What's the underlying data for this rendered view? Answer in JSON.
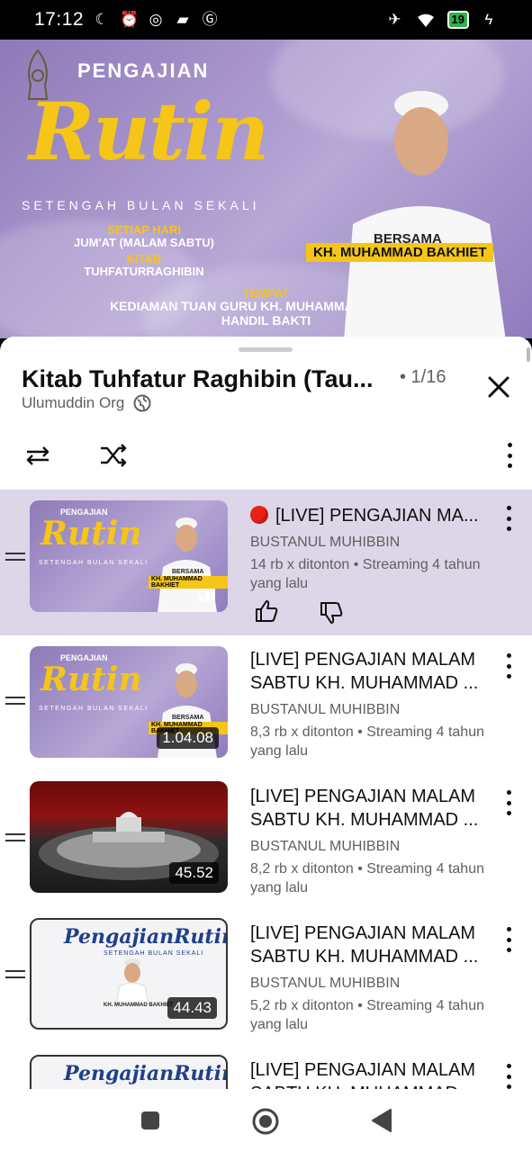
{
  "status_bar": {
    "time": "17:12",
    "battery": "19"
  },
  "video": {
    "title_top": "PENGAJIAN",
    "title_main": "Rutin",
    "subtitle": "SETENGAH BULAN SEKALI",
    "line1": "SETIAP HARI",
    "line2": "JUM'AT (MALAM SABTU)",
    "line3": "KITAB",
    "line4": "TUHFATURRAGHIBIN",
    "place_label": "TEMPAT",
    "place1": "KEDIAMAN TUAN GURU KH. MUHAMMAD BAKHIET",
    "place2": "HANDIL BAKTI",
    "with_label": "BERSAMA",
    "speaker": "KH. MUHAMMAD BAKHIET"
  },
  "playlist": {
    "title": "Kitab Tuhfatur Raghibin (Tau...",
    "position": "• 1/16",
    "channel": "Ulumuddin Org",
    "items": [
      {
        "title": "[LIVE] PENGAJIAN MA...",
        "channel": "BUSTANUL MUHIBBIN",
        "meta": "14 rb x ditonton • Streaming 4 tahun yang lalu"
      },
      {
        "title": "[LIVE] PENGAJIAN MALAM SABTU KH. MUHAMMAD ...",
        "channel": "BUSTANUL MUHIBBIN",
        "meta": "8,3 rb x ditonton • Streaming 4 tahun yang lalu",
        "duration": "1.04.08"
      },
      {
        "title": "[LIVE] PENGAJIAN MALAM SABTU KH. MUHAMMAD ...",
        "channel": "BUSTANUL MUHIBBIN",
        "meta": "8,2 rb x ditonton • Streaming 4 tahun yang lalu",
        "duration": "45.52"
      },
      {
        "title": "[LIVE] PENGAJIAN MALAM SABTU KH. MUHAMMAD ...",
        "channel": "BUSTANUL MUHIBBIN",
        "meta": "5,2 rb x ditonton • Streaming 4 tahun yang lalu",
        "duration": "44.43"
      },
      {
        "title": "[LIVE] PENGAJIAN MALAM SABTU KH. MUHAMMAD ..."
      }
    ]
  },
  "thumb_text": {
    "pengajian": "PENGAJIAN",
    "rutin": "Rutin",
    "setengah": "SETENGAH BULAN SEKALI",
    "bersama": "BERSAMA",
    "speaker": "KH. MUHAMMAD BAKHIET",
    "pengajian_rutin": "PengajianRutin"
  },
  "colors": {
    "accent_yellow": "#f5c518",
    "live_red": "#e62117",
    "active_row": "#ddd5e8"
  }
}
